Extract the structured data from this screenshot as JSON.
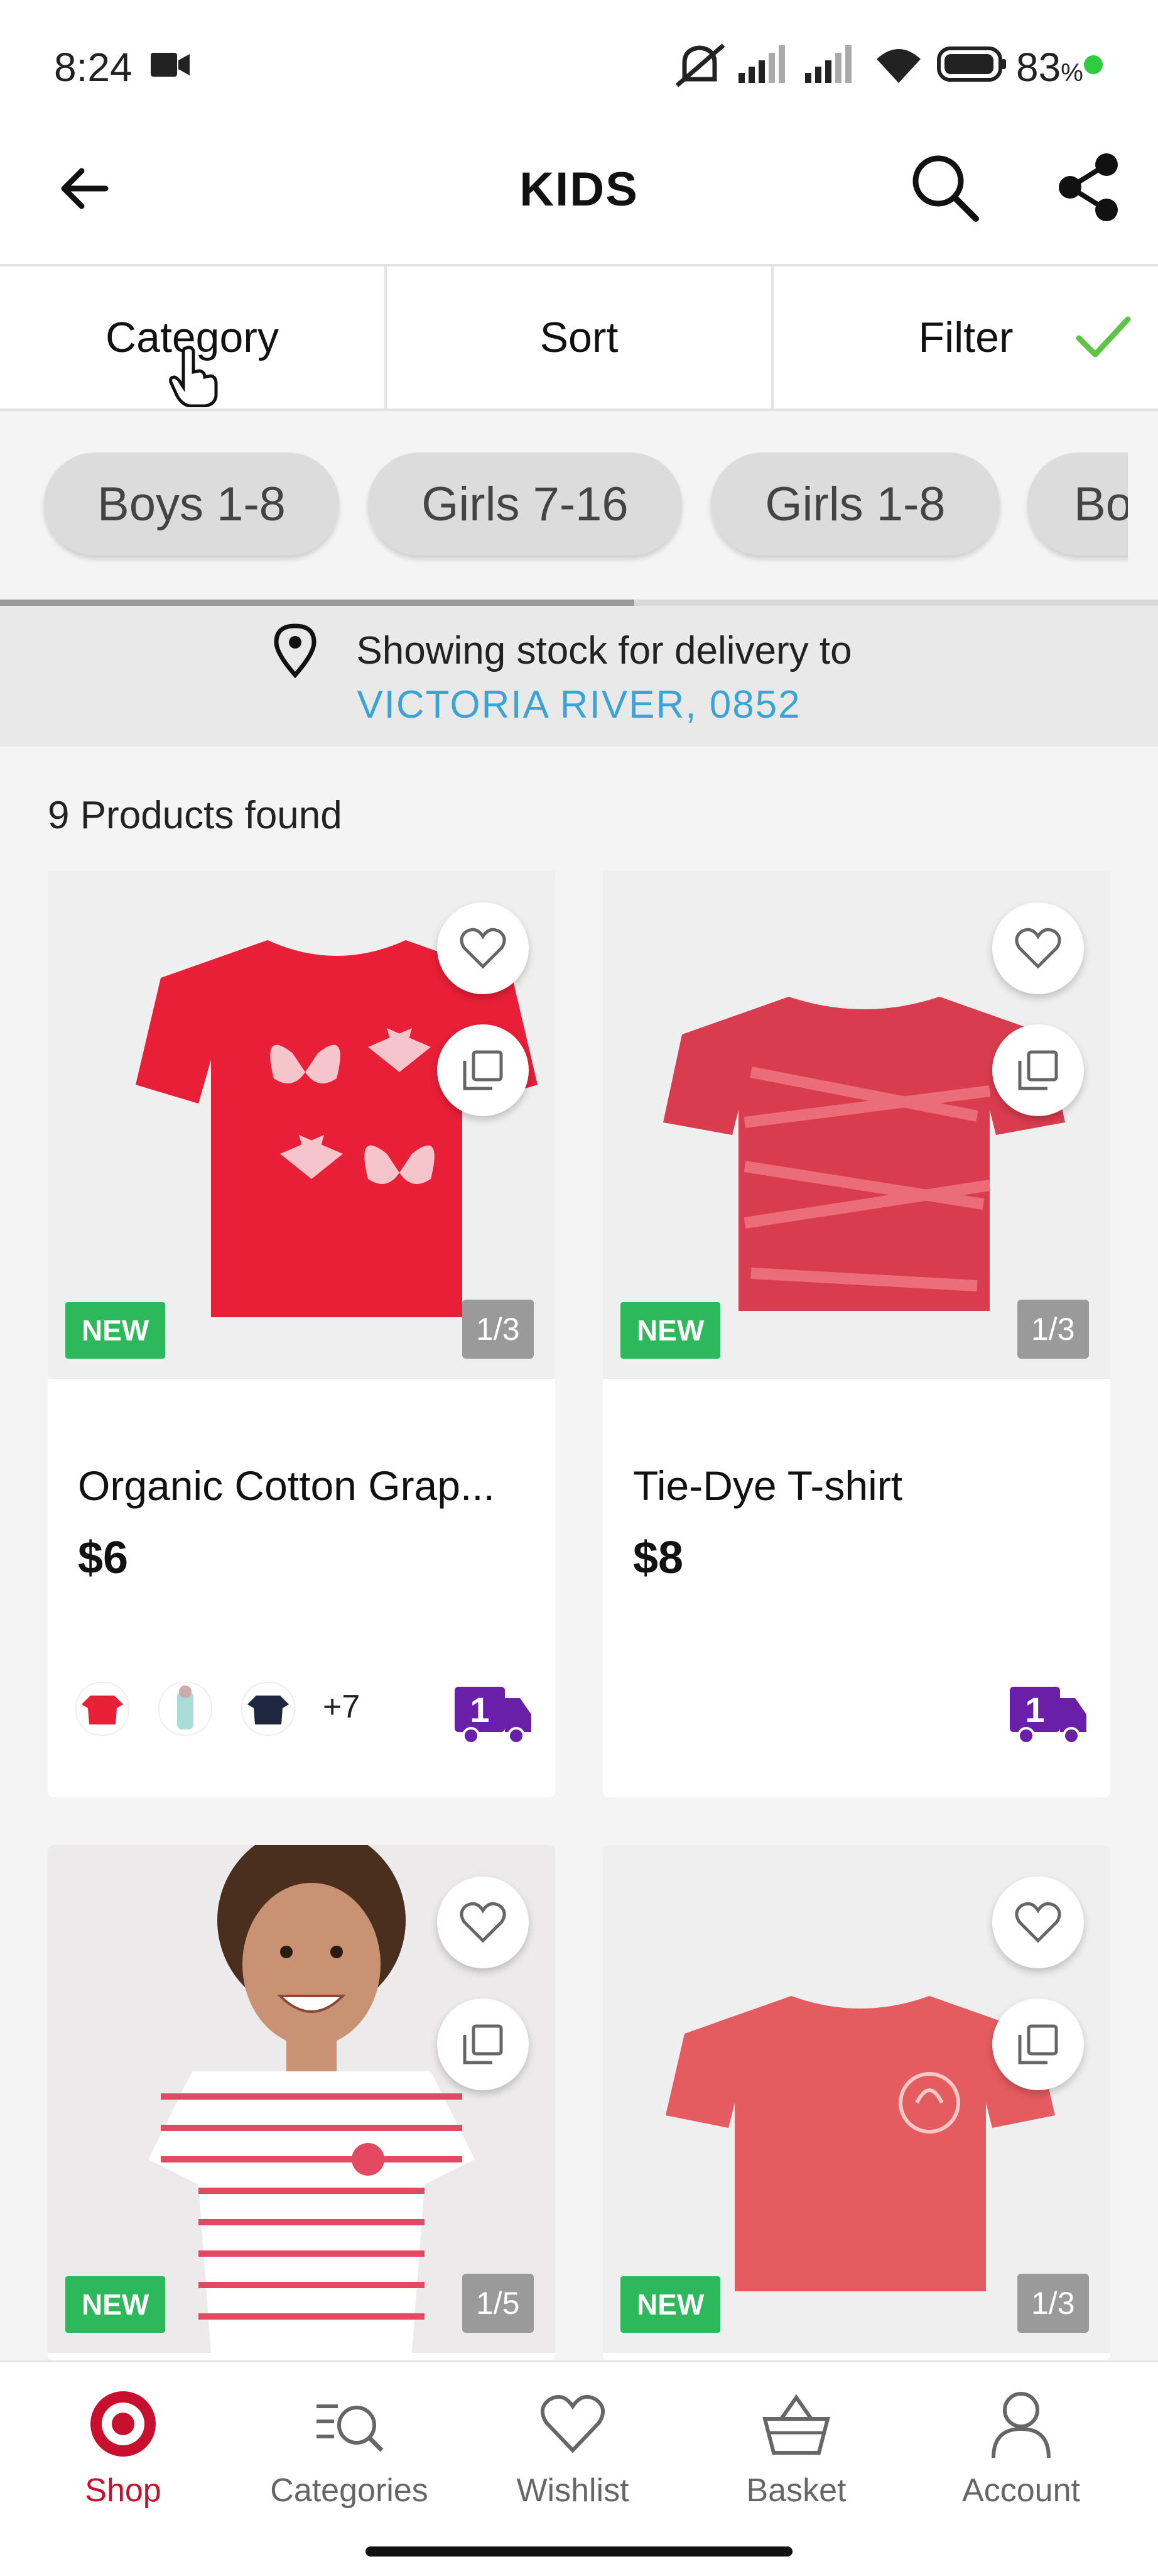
{
  "status_bar": {
    "time": "8:24",
    "battery": "83"
  },
  "header": {
    "title": "KIDS"
  },
  "tabs": [
    {
      "label": "Category"
    },
    {
      "label": "Sort"
    },
    {
      "label": "Filter"
    }
  ],
  "chips": [
    {
      "label": "Boys 1-8"
    },
    {
      "label": "Girls 7-16"
    },
    {
      "label": "Girls 1-8"
    },
    {
      "label": "Bo"
    }
  ],
  "location": {
    "line1": "Showing stock for delivery to",
    "place": "VICTORIA RIVER, 0852"
  },
  "results": {
    "count_text": "9 Products found"
  },
  "products": [
    {
      "name": "Organic Cotton Grap...",
      "price": "$6",
      "badge": "NEW",
      "image_count": "1/3",
      "more_colors": "+7",
      "color": "#e81f36"
    },
    {
      "name": "Tie-Dye T-shirt",
      "price": "$8",
      "badge": "NEW",
      "image_count": "1/3",
      "color": "#d93c4e"
    },
    {
      "badge": "NEW",
      "image_count": "1/5"
    },
    {
      "badge": "NEW",
      "image_count": "1/3",
      "color": "#e45b60"
    }
  ],
  "bottom_nav": [
    {
      "label": "Shop",
      "icon": "target-icon",
      "active": true
    },
    {
      "label": "Categories",
      "icon": "categories-search-icon"
    },
    {
      "label": "Wishlist",
      "icon": "heart-icon"
    },
    {
      "label": "Basket",
      "icon": "basket-icon"
    },
    {
      "label": "Account",
      "icon": "person-icon"
    }
  ],
  "colors": {
    "brand_red": "#c8102e",
    "link_blue": "#3ba4d6",
    "new_green": "#2eb85c",
    "delivery_purple": "#6a1fa8"
  }
}
